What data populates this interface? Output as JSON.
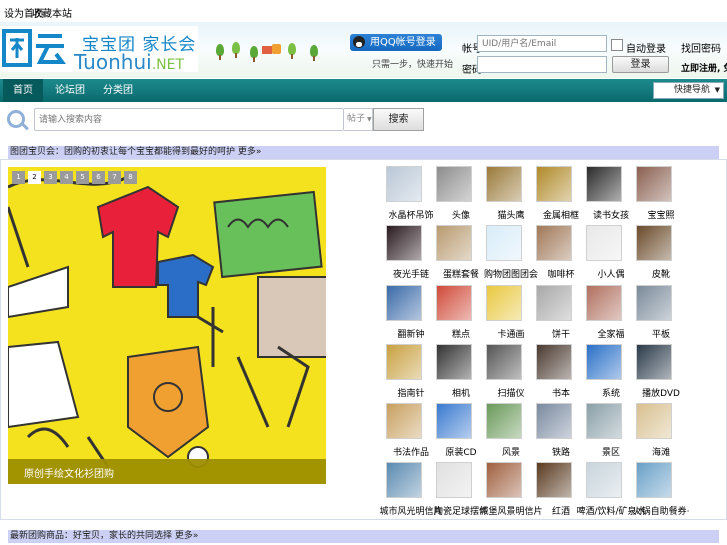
{
  "topbar": {
    "left_link": "设为首页",
    "right_link": "收藏本站"
  },
  "logo": {
    "cn": "宝宝团 家长会",
    "en_main": "Tuonhui",
    "en_suffix": ".NET"
  },
  "qq": {
    "button_label": "用QQ帐号登录",
    "note": "只需一步，快速开始"
  },
  "login": {
    "account_label": "帐号",
    "account_placeholder": "UID/用户名/Email",
    "password_label": "密码",
    "remember_label": "自动登录",
    "forgot_label": "找回密码",
    "login_button": "登录",
    "register_label": "立即注册, 免费注册"
  },
  "nav": {
    "items": [
      "首页",
      "论坛团",
      "分类团"
    ],
    "select_label": "快捷导航"
  },
  "search": {
    "placeholder": "请输入搜索内容",
    "type": "帖子",
    "button": "搜索"
  },
  "section1": {
    "title": "图团宝贝会：团购的初衷让每个宝宝都能得到最好的呵护 更多»"
  },
  "section2": {
    "title": "最新团购商品：好宝贝，家长的共同选择 更多»"
  },
  "slideshow": {
    "pages": [
      "1",
      "2",
      "3",
      "4",
      "5",
      "6",
      "7",
      "8"
    ],
    "active_page": 2,
    "caption": "原创手绘文化衫团购"
  },
  "products": [
    {
      "label": "水晶杯吊饰",
      "color": "#b9c7d6"
    },
    {
      "label": "头像",
      "color": "#8d8d8d"
    },
    {
      "label": "猫头鹰",
      "color": "#9a7a3a"
    },
    {
      "label": "金属相框",
      "color": "#b08a2a"
    },
    {
      "label": "读书女孩",
      "color": "#2a2a2a"
    },
    {
      "label": "宝宝照",
      "color": "#8a6050"
    },
    {
      "label": "夜光手链",
      "color": "#2a1a20"
    },
    {
      "label": "蛋糕套餐",
      "color": "#b89a70"
    },
    {
      "label": "购物团图团会",
      "color": "#d8ecf8"
    },
    {
      "label": "咖啡杯",
      "color": "#a07858"
    },
    {
      "label": "小人偶",
      "color": "#e8e8e8"
    },
    {
      "label": "皮靴",
      "color": "#6a4a2a"
    },
    {
      "label": "翻新钟",
      "color": "#3a6aa8"
    },
    {
      "label": "糕点",
      "color": "#d04a3a"
    },
    {
      "label": "卡通画",
      "color": "#e8c840"
    },
    {
      "label": "饼干",
      "color": "#a8a8a8"
    },
    {
      "label": "全家福",
      "color": "#b07060"
    },
    {
      "label": "平板",
      "color": "#7a8a9a"
    },
    {
      "label": "指南针",
      "color": "#c8a040"
    },
    {
      "label": "相机",
      "color": "#333333"
    },
    {
      "label": "扫描仪",
      "color": "#555555"
    },
    {
      "label": "书本",
      "color": "#4a3a30"
    },
    {
      "label": "系统",
      "color": "#2a70c8"
    },
    {
      "label": "播放DVD",
      "color": "#2a3a4a"
    },
    {
      "label": "书法作品",
      "color": "#c8a060"
    },
    {
      "label": "原装CD",
      "color": "#3a7ad0"
    },
    {
      "label": "风景",
      "color": "#6a9a5a"
    },
    {
      "label": "铁路",
      "color": "#7a8aa0"
    },
    {
      "label": "景区",
      "color": "#8aa0a8"
    },
    {
      "label": "海滩",
      "color": "#d8c090"
    },
    {
      "label": "城市风光明信片",
      "color": "#5a8ab0"
    },
    {
      "label": "陶瓷足球摆件",
      "color": "#e0e0e0"
    },
    {
      "label": "城堡风景明信片",
      "color": "#a06040"
    },
    {
      "label": "红酒",
      "color": "#5a3a20"
    },
    {
      "label": "啤酒/饮料/矿泉水",
      "color": "#c8d4dc"
    },
    {
      "label": "火锅自助餐券·",
      "color": "#6aa0c8"
    }
  ]
}
